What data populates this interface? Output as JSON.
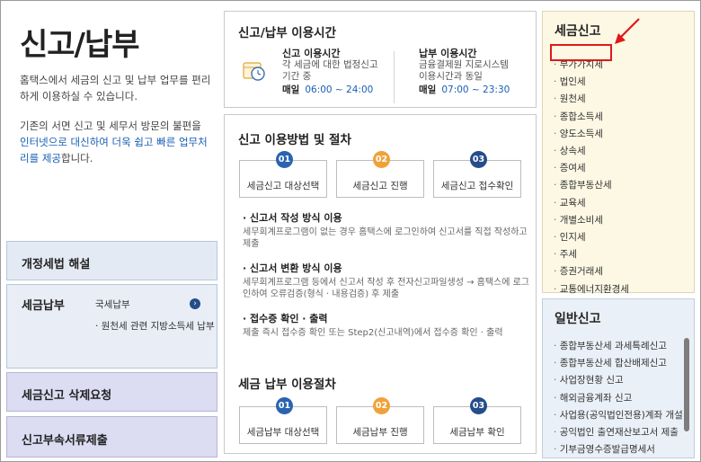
{
  "page": {
    "title": "신고/납부",
    "intro1": "홈택스에서 세금의 신고 및 납부 업무를 편리하게 이용하실 수 있습니다.",
    "intro2_a": "기존의 서면 신고 및 세무서 방문의 불편을",
    "intro2_link": "인터넷으로 대신하여 더욱 쉽고 빠른 업무처리를 제공",
    "intro2_b": "합니다."
  },
  "left_menu": {
    "revision": "개정세법 해설",
    "payment": "세금납부",
    "payment_sub1": "국세납부",
    "payment_sub2": "· 원천세 관련 지방소득세 납부",
    "delete_request": "세금신고 삭제요청",
    "attachments": "신고부속서류제출"
  },
  "hours": {
    "title": "신고/납부 이용시간",
    "report_title": "신고 이용시간",
    "report_desc1": "각 세금에 대한 법정신고",
    "report_desc2": "기간 중",
    "report_daily": "매일",
    "report_time": "06:00 ~ 24:00",
    "pay_title": "납부 이용시간",
    "pay_desc1": "금융결제원 지로시스템",
    "pay_desc2": "이용시간과 동일",
    "pay_daily": "매일",
    "pay_time": "07:00 ~ 23:30"
  },
  "procedure": {
    "title": "신고 이용방법 및 절차",
    "steps": [
      {
        "num": "01",
        "label": "세금신고 대상선택"
      },
      {
        "num": "02",
        "label": "세금신고 진행"
      },
      {
        "num": "03",
        "label": "세금신고 접수확인"
      }
    ],
    "methods": [
      {
        "title": "신고서 작성 방식 이용",
        "desc": "세무회계프로그램이 없는 경우 홈택스에 로그인하여 신고서를 직접 작성하고 제출"
      },
      {
        "title": "신고서 변환 방식 이용",
        "desc": "세무회계프로그램 등에서 신고서 작성 후 전자신고파일생성 → 홈택스에 로그인하여 오류검증(형식 · 내용검증) 후 제출"
      },
      {
        "title": "접수증 확인 · 출력",
        "desc": "제출 즉시 접수증 확인 또는 Step2(신고내역)에서 접수증 확인 · 출력"
      }
    ],
    "pay_title": "세금 납부 이용절차",
    "pay_steps": [
      {
        "num": "01",
        "label": "세금납부 대상선택"
      },
      {
        "num": "02",
        "label": "세금납부 진행"
      },
      {
        "num": "03",
        "label": "세금납부 확인"
      }
    ]
  },
  "tax_report": {
    "title": "세금신고",
    "items": [
      "부가가치세",
      "법인세",
      "원천세",
      "종합소득세",
      "양도소득세",
      "상속세",
      "증여세",
      "종합부동산세",
      "교육세",
      "개별소비세",
      "인지세",
      "주세",
      "증권거래세",
      "교통에너지환경세"
    ]
  },
  "general_report": {
    "title": "일반신고",
    "items": [
      "종합부동산세 과세특례신고",
      "종합부동산세 합산배제신고",
      "사업장현황 신고",
      "해외금융계좌 신고",
      "사업용(공익법인전용)계좌 개설",
      "공익법인 출연재산보고서 제출",
      "기부금영수증발급명세서"
    ]
  },
  "colors": {
    "highlight": "#e01818",
    "link": "#1a5fb4",
    "step_blue": "#2a64b0",
    "step_orange": "#f0a23a"
  }
}
